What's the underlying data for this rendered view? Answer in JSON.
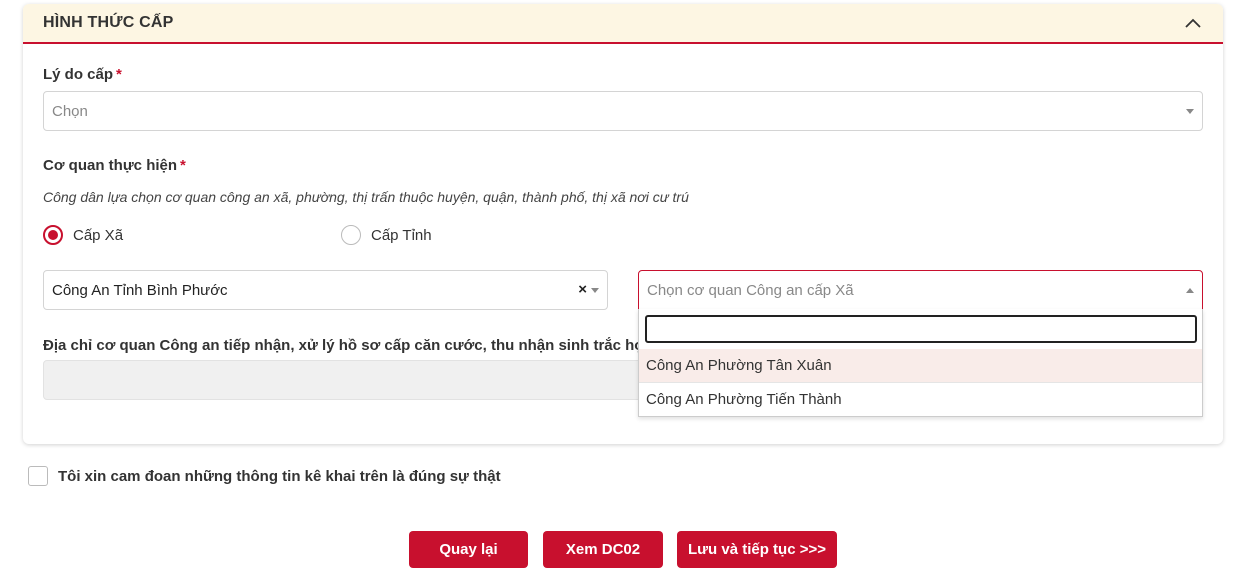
{
  "section": {
    "title": "HÌNH THỨC CẤP"
  },
  "reason": {
    "label": "Lý do cấp",
    "required_mark": "*",
    "placeholder": "Chọn"
  },
  "agency": {
    "label": "Cơ quan thực hiện",
    "required_mark": "*",
    "hint": "Công dân lựa chọn cơ quan công an xã, phường, thị trấn thuộc huyện, quận, thành phố, thị xã nơi cư trú",
    "levels": [
      {
        "label": "Cấp Xã",
        "checked": true
      },
      {
        "label": "Cấp Tỉnh",
        "checked": false
      }
    ],
    "province_value": "Công An Tỉnh Bình Phước",
    "clear_symbol": "×",
    "ward_placeholder": "Chọn cơ quan Công an cấp Xã",
    "ward_search_value": "",
    "ward_options": [
      "Công An Phường Tân Xuân",
      "Công An Phường Tiến Thành"
    ]
  },
  "address": {
    "label": "Địa chỉ cơ quan Công an tiếp nhận, xử lý hồ sơ cấp căn cước, thu nhận sinh trắc học"
  },
  "commitment": {
    "label": "Tôi xin cam đoan những thông tin kê khai trên là đúng sự thật",
    "checked": false
  },
  "buttons": {
    "back": "Quay lại",
    "view": "Xem DC02",
    "save": "Lưu và tiếp tục >>>"
  },
  "colors": {
    "accent": "#c8102e",
    "header_bg": "#fdf6e3",
    "option_hover": "#f9ece9"
  },
  "icons": {
    "collapse": "chevron-up-icon"
  }
}
